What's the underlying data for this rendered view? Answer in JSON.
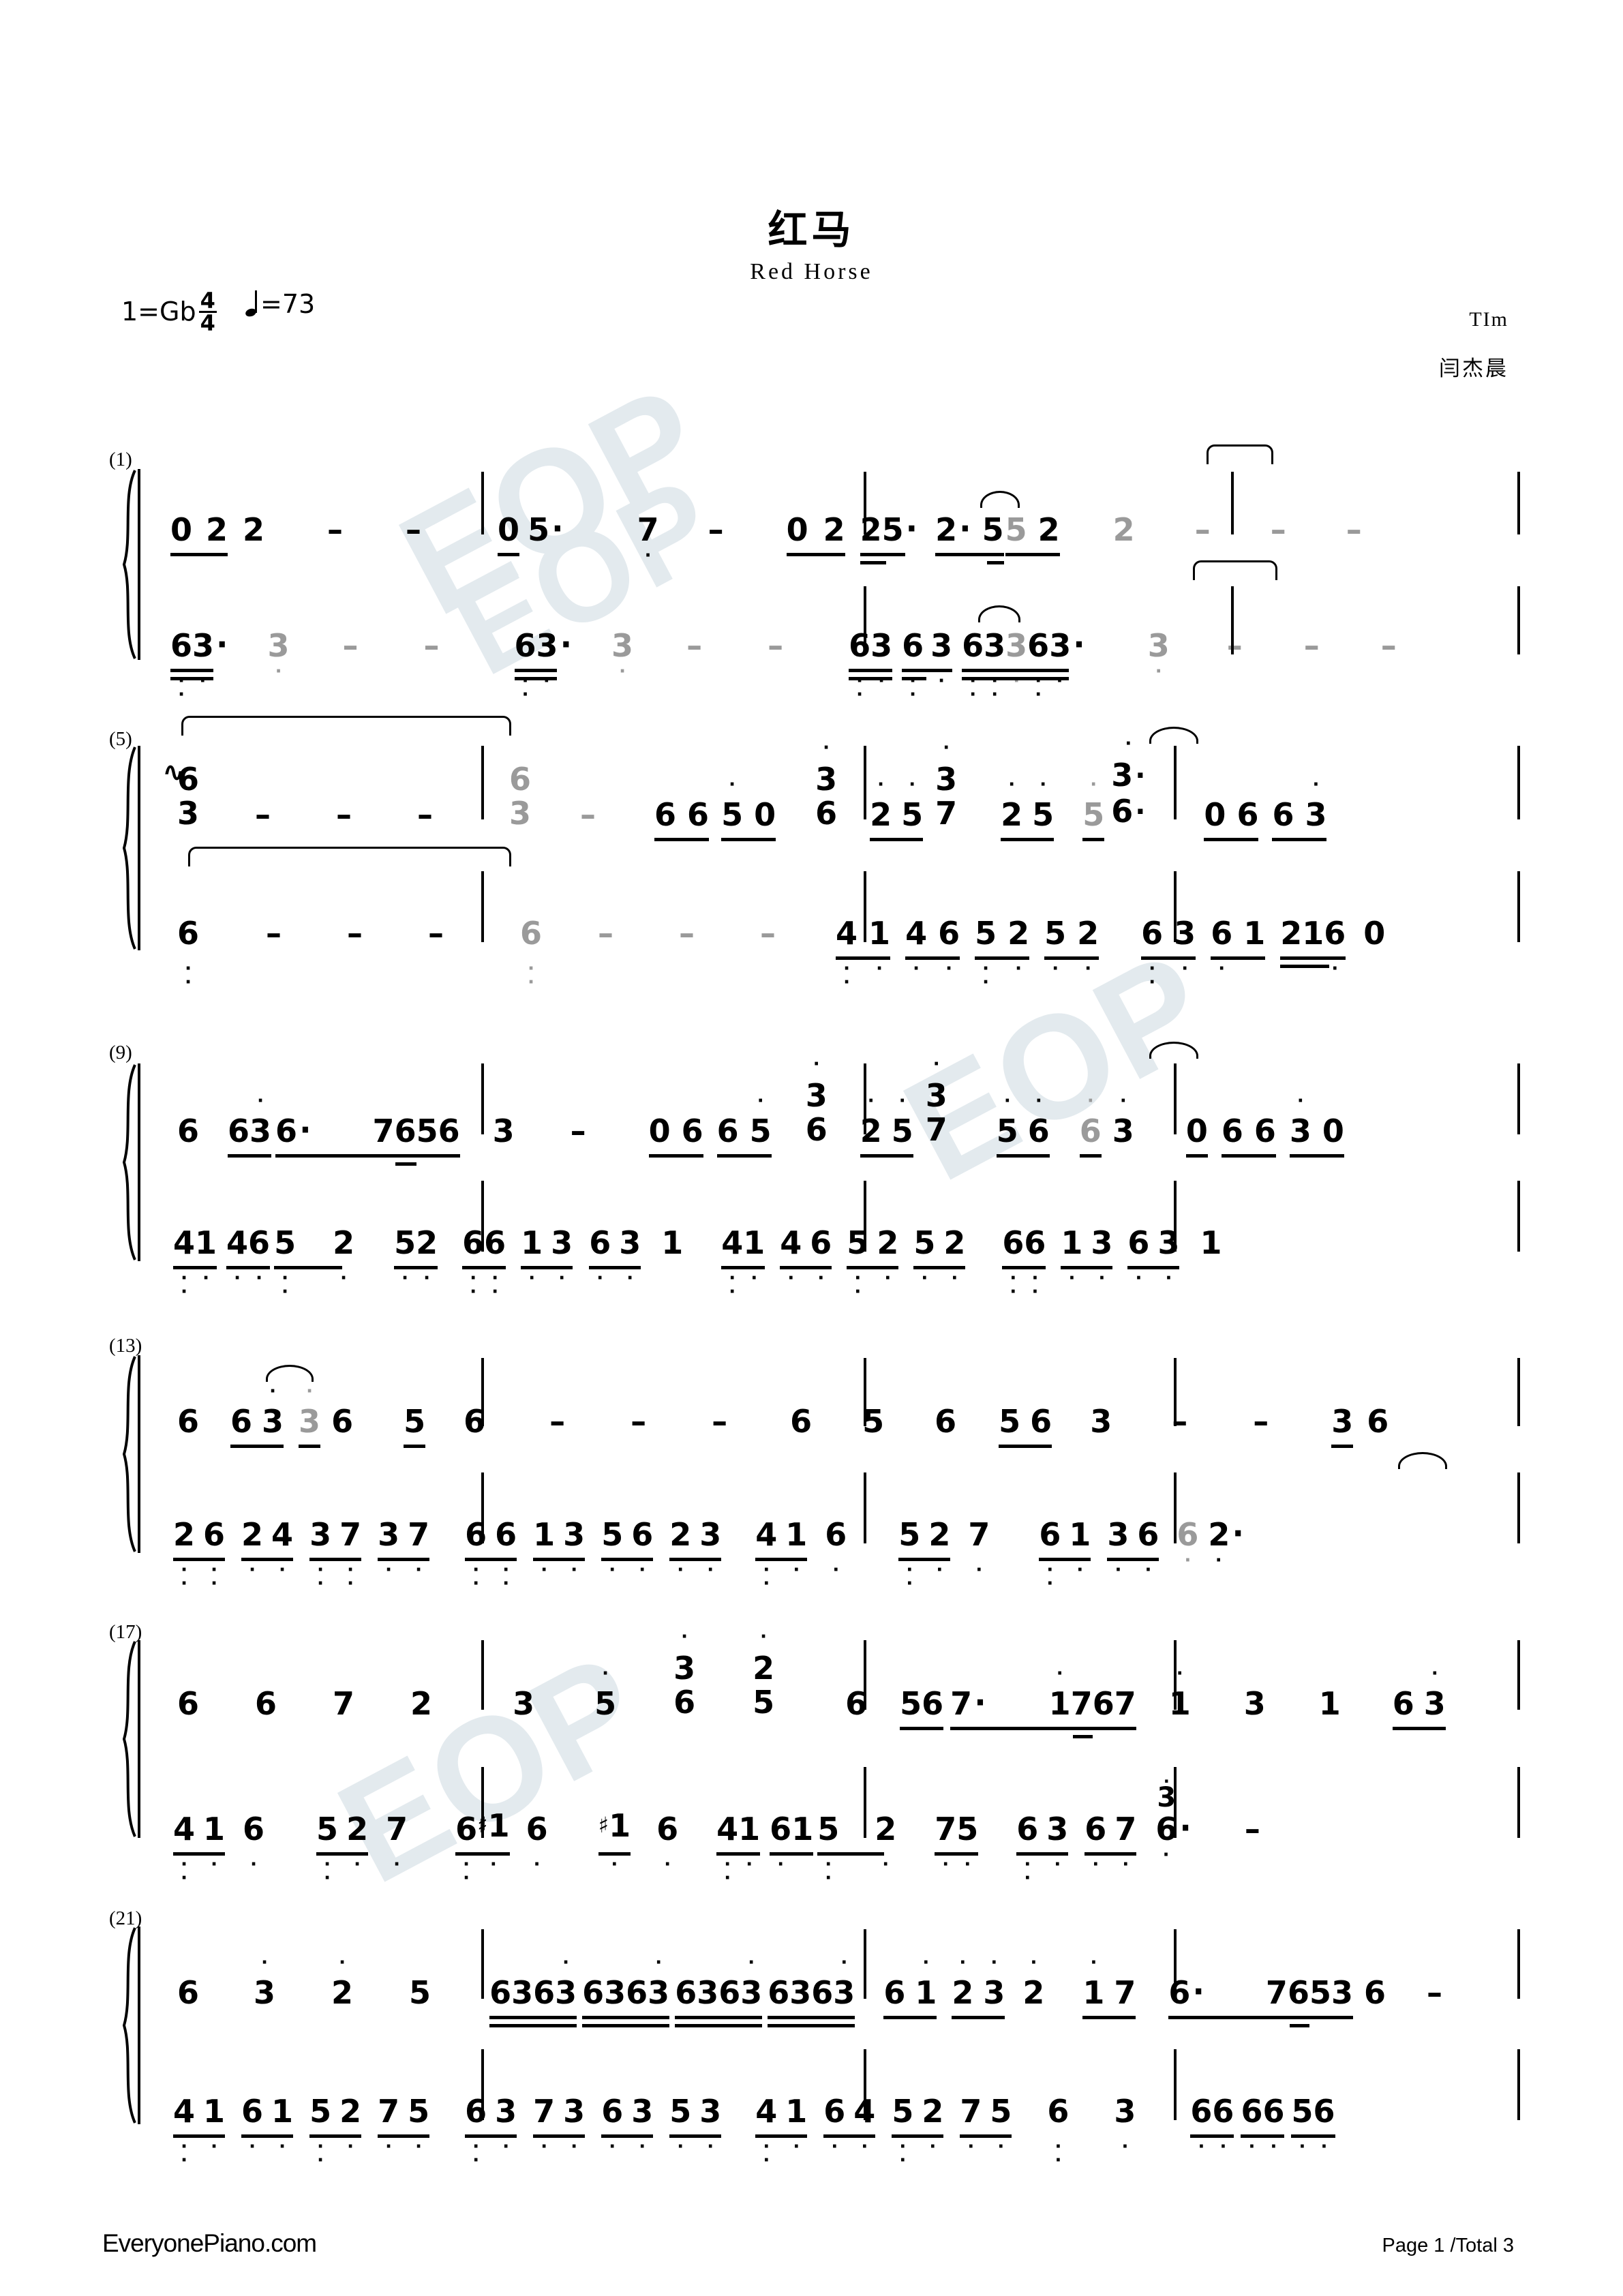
{
  "document": {
    "title_cn": "红马",
    "title_en": "Red Horse",
    "key_label": "1=Gb",
    "time_num": "4",
    "time_den": "4",
    "tempo_label": "=73",
    "composer": "TIm",
    "arranger": "闫杰晨",
    "footer_site": "EveryonePiano.com",
    "footer_page": "Page 1 /Total 3",
    "watermark_text": "EOP",
    "notation_type": "jianpu-numbered-musical-notation",
    "colors": {
      "ink": "#000000",
      "tied_gray": "#9a9a9a",
      "watermark": "#e3eaee"
    }
  },
  "systems": [
    {
      "label": "(1)",
      "measures_from": 1,
      "treble": [
        {
          "measure": 1,
          "notes": "0 2 2  -  -"
        },
        {
          "measure": 2,
          "notes": "0 5. 7 -"
        },
        {
          "measure": 3,
          "notes": "0 2 25. 2. 5 5 2"
        },
        {
          "measure": 4,
          "notes": "2 - - - -"
        }
      ],
      "bass": [
        {
          "measure": 1,
          "notes": "63. 3 - -"
        },
        {
          "measure": 2,
          "notes": "63. 3 - -"
        },
        {
          "measure": 3,
          "notes": "63 63 63 363."
        },
        {
          "measure": 4,
          "notes": "3 - - -"
        }
      ]
    },
    {
      "label": "(5)",
      "measures_from": 5,
      "treble": [
        {
          "measure": 5,
          "notes": "6/3 chord - - -"
        },
        {
          "measure": 6,
          "notes": "6/3 chord - 6 6 5 0"
        },
        {
          "measure": 7,
          "notes": "3/6 2 5 3/7 2 5"
        },
        {
          "measure": 8,
          "notes": "5 3./6. 0 6 6 3"
        }
      ],
      "bass": [
        {
          "measure": 5,
          "notes": "6 - - -"
        },
        {
          "measure": 6,
          "notes": "6 - - -"
        },
        {
          "measure": 7,
          "notes": "41 46 52 52"
        },
        {
          "measure": 8,
          "notes": "63 61 216 0"
        }
      ]
    },
    {
      "label": "(9)",
      "measures_from": 9,
      "treble": [
        {
          "measure": 9,
          "notes": "6 63 6. 76 56"
        },
        {
          "measure": 10,
          "notes": "3 - 0 6 6 5"
        },
        {
          "measure": 11,
          "notes": "3/6 2 5 3/7 5 6"
        },
        {
          "measure": 12,
          "notes": "6 3 0 6 6 3 0"
        }
      ],
      "bass": [
        {
          "measure": 9,
          "notes": "41 46 5 2 52"
        },
        {
          "measure": 10,
          "notes": "66 13 63 1"
        },
        {
          "measure": 11,
          "notes": "41 46 52 52"
        },
        {
          "measure": 12,
          "notes": "66 13 63 1"
        }
      ]
    },
    {
      "label": "(13)",
      "measures_from": 13,
      "treble": [
        {
          "measure": 13,
          "notes": "6 63 3 6 5"
        },
        {
          "measure": 14,
          "notes": "6 - - -"
        },
        {
          "measure": 15,
          "notes": "6 5 6 56"
        },
        {
          "measure": 16,
          "notes": "3 - - 3 6"
        }
      ],
      "bass": [
        {
          "measure": 13,
          "notes": "26 24 37 37"
        },
        {
          "measure": 14,
          "notes": "66 13 56 23"
        },
        {
          "measure": 15,
          "notes": "41 6 52 7"
        },
        {
          "measure": 16,
          "notes": "61 36 6 2."
        }
      ]
    },
    {
      "label": "(17)",
      "measures_from": 17,
      "treble": [
        {
          "measure": 17,
          "notes": "6 6 7 2"
        },
        {
          "measure": 18,
          "notes": "3 5 3/6 2/5"
        },
        {
          "measure": 19,
          "notes": "6 56 7. 17 67"
        },
        {
          "measure": 20,
          "notes": "1 3 1 6 3"
        }
      ],
      "bass": [
        {
          "measure": 17,
          "notes": "41 6 52 7"
        },
        {
          "measure": 18,
          "notes": "6 #1 6 #1 6"
        },
        {
          "measure": 19,
          "notes": "41 61 5 2 75"
        },
        {
          "measure": 20,
          "notes": "63 67 6 (3) -"
        }
      ]
    },
    {
      "label": "(21)",
      "measures_from": 21,
      "treble": [
        {
          "measure": 21,
          "notes": "6 3 2 5"
        },
        {
          "measure": 22,
          "notes": "6363 6363 6363 6363"
        },
        {
          "measure": 23,
          "notes": "6 1 2 3 2 1 7"
        },
        {
          "measure": 24,
          "notes": "6. 76 53 6 -"
        }
      ],
      "bass": [
        {
          "measure": 21,
          "notes": "41 61 52 75"
        },
        {
          "measure": 22,
          "notes": "63 73 63 53"
        },
        {
          "measure": 23,
          "notes": "41 64 52 75"
        },
        {
          "measure": 24,
          "notes": "6 3 66 66 56"
        }
      ]
    }
  ]
}
